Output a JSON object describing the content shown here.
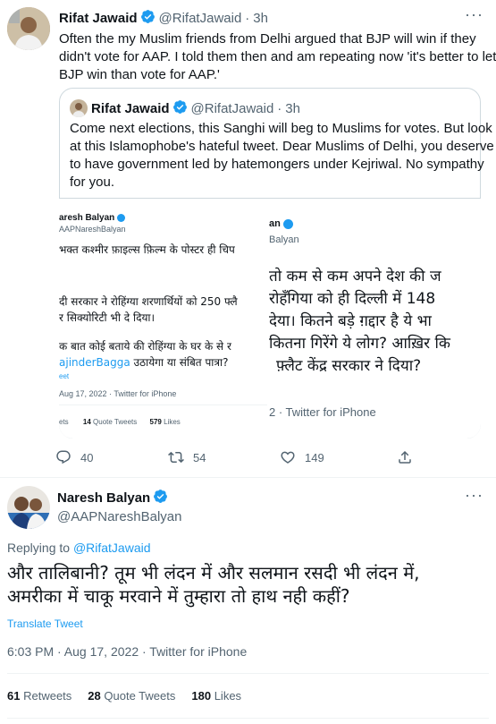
{
  "top_tweet": {
    "author_name": "Rifat Jawaid",
    "handle": "@RifatJawaid",
    "time": "3h",
    "text_lines": [
      "Often the my Muslim friends from Delhi argued that BJP will win if they",
      "didn't vote for AAP. I told them then and am repeating now 'it's better to let",
      "BJP win than vote for AAP.'"
    ],
    "quoted": {
      "author_name": "Rifat Jawaid",
      "handle": "@RifatJawaid",
      "time": "3h",
      "text_lines": [
        "Come next elections, this Sanghi will beg to Muslims for votes. But look",
        "at this Islamophobe's hateful tweet. Dear Muslims of Delhi, you deserve",
        "to have government led by hatemongers under Kejriwal. No sympathy",
        "for you."
      ],
      "img_left": {
        "name": "aresh Balyan",
        "handle": "AAPNareshBalyan",
        "line1": "भक्त कश्मीर फ़ाइल्स फ़िल्म के पोस्टर ही चिप",
        "line2": "दी सरकार ने रोहिंग्या शरणार्थियों को 250 फ्लै",
        "line3": "र सिक्योरिटी भी दे दिया।",
        "line4": "क बात कोई बताये की रोहिंग्या के घर के से र",
        "mention": "ajinderBagga",
        "line5": " उठायेगा या संबित पात्रा?",
        "source_link": "eet",
        "meta": "Aug 17, 2022 · Twitter for iPhone",
        "stat1_label": "ets",
        "stat2_num": "14",
        "stat2_label": "Quote Tweets",
        "stat3_num": "579",
        "stat3_label": "Likes"
      },
      "img_right": {
        "name": "an",
        "handle": "Balyan",
        "line1": "तो कम से कम अपने देश की ज",
        "line2": "रोहँगिया को ही दिल्ली में 148",
        "line3": "देया। कितने बड़े ग़द्दार है ये भा",
        "line4": "कितना गिरेंगे ये लोग? आख़िर कि",
        "line5": "फ़्लैट केंद्र सरकार ने दिया?",
        "meta": "2 · Twitter for iPhone"
      }
    },
    "actions": {
      "reply_count": "40",
      "retweet_count": "54",
      "like_count": "149"
    }
  },
  "main_tweet": {
    "author_name": "Naresh Balyan",
    "handle": "@AAPNareshBalyan",
    "replying_prefix": "Replying to",
    "replying_to": "@RifatJawaid",
    "text_line1": "और तालिबानी? तूम भी लंदन में और सलमान रसदी भी लंदन में,",
    "text_line2": "अमरीका में चाकू मरवाने में तुम्हारा तो हाथ नही कहीं?",
    "translate": "Translate Tweet",
    "timestamp": "6:03 PM · Aug 17, 2022 · Twitter for iPhone",
    "retweets_num": "61",
    "retweets_label": "Retweets",
    "quotes_num": "28",
    "quotes_label": "Quote Tweets",
    "likes_num": "180",
    "likes_label": "Likes"
  },
  "colors": {
    "accent": "#1d9bf0",
    "text": "#0f1419",
    "muted": "#536471",
    "border": "#cfd9de"
  }
}
